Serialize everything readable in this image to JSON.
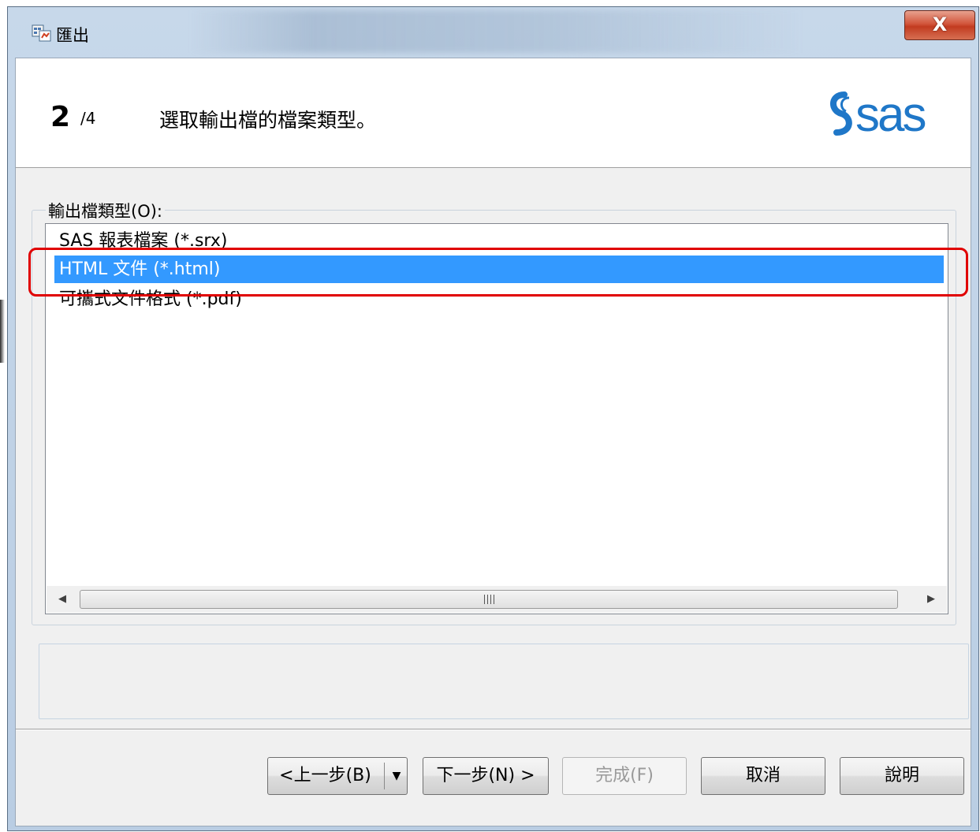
{
  "window": {
    "title": "匯出",
    "close_label": "X"
  },
  "header": {
    "step_current": "2",
    "step_total": "/4",
    "instruction": "選取輸出檔的檔案類型。",
    "logo_text": "sas"
  },
  "file_types": {
    "group_label": "輸出檔類型(O):",
    "items": [
      {
        "label": "SAS 報表檔案 (*.srx)",
        "selected": false
      },
      {
        "label": "HTML 文件 (*.html)",
        "selected": true
      },
      {
        "label": "可攜式文件格式 (*.pdf)",
        "selected": false
      }
    ],
    "scrollbar_grip": "III"
  },
  "buttons": {
    "back": "<上一步(B)",
    "back_dropdown": "▼",
    "next": "下一步(N) >",
    "finish": "完成(F)",
    "cancel": "取消",
    "help": "說明"
  },
  "colors": {
    "selection": "#3399ff",
    "highlight_annotation": "#e00000",
    "logo_blue": "#1f77c8"
  }
}
